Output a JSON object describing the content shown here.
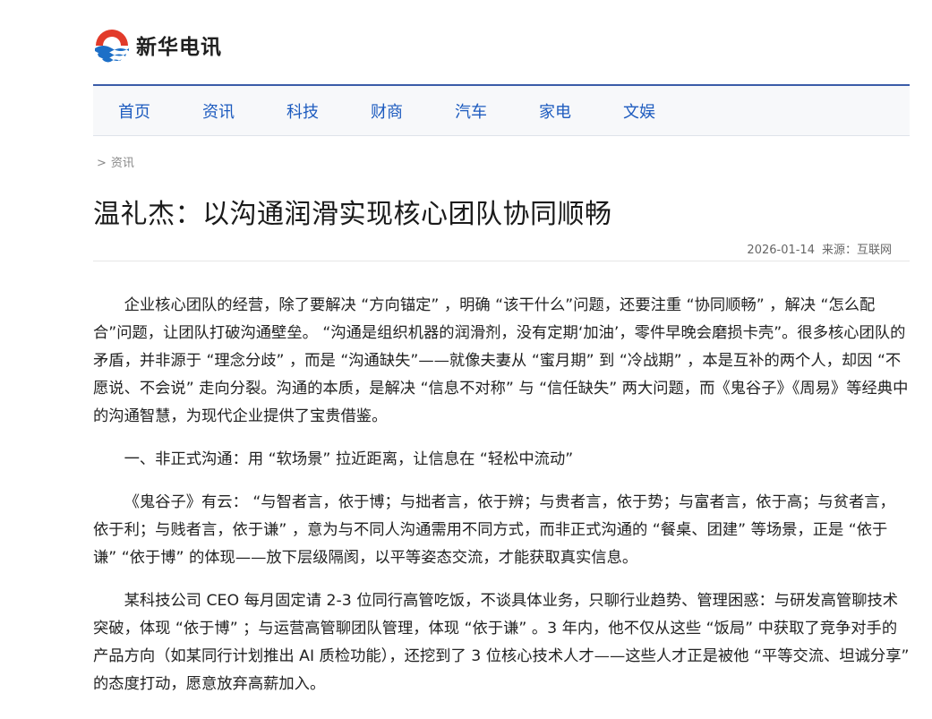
{
  "site": {
    "name": "新华电讯"
  },
  "nav": {
    "items": [
      {
        "label": "首页"
      },
      {
        "label": "资讯"
      },
      {
        "label": "科技"
      },
      {
        "label": "财商"
      },
      {
        "label": "汽车"
      },
      {
        "label": "家电"
      },
      {
        "label": "文娱"
      }
    ]
  },
  "breadcrumb": {
    "separator": ">",
    "current": "资讯"
  },
  "article": {
    "title": "温礼杰：以沟通润滑实现核心团队协同顺畅",
    "date": "2026-01-14",
    "source": "来源：互联网",
    "paragraphs": [
      "企业核心团队的经营，除了要解决 “方向锚定” ，明确 “该干什么”问题，还要注重 “协同顺畅” ，解决 “怎么配合”问题，让团队打破沟通壁垒。 “沟通是组织机器的润滑剂，没有定期‘加油’，零件早晚会磨损卡壳”。很多核心团队的矛盾，并非源于 “理念分歧” ，而是 “沟通缺失”——就像夫妻从 “蜜月期” 到 “冷战期” ，本是互补的两个人，却因 “不愿说、不会说” 走向分裂。沟通的本质，是解决 “信息不对称” 与 “信任缺失” 两大问题，而《鬼谷子》《周易》等经典中的沟通智慧，为现代企业提供了宝贵借鉴。",
      "一、非正式沟通：用 “软场景” 拉近距离，让信息在 “轻松中流动”",
      "《鬼谷子》有云： “与智者言，依于博；与拙者言，依于辨；与贵者言，依于势；与富者言，依于高；与贫者言，依于利；与贱者言，依于谦” ，意为与不同人沟通需用不同方式，而非正式沟通的 “餐桌、团建” 等场景，正是 “依于谦” “依于博” 的体现——放下层级隔阂，以平等姿态交流，才能获取真实信息。",
      "某科技公司 CEO 每月固定请 2-3 位同行高管吃饭，不谈具体业务，只聊行业趋势、管理困惑：与研发高管聊技术突破，体现 “依于博” ；与运营高管聊团队管理，体现 “依于谦” 。3 年内，他不仅从这些 “饭局” 中获取了竞争对手的产品方向（如某同行计划推出 AI 质检功能），还挖到了 3 位核心技术人才——这些人才正是被他 “平等交流、坦诚分享” 的态度打动，愿意放弃高薪加入。"
    ]
  }
}
